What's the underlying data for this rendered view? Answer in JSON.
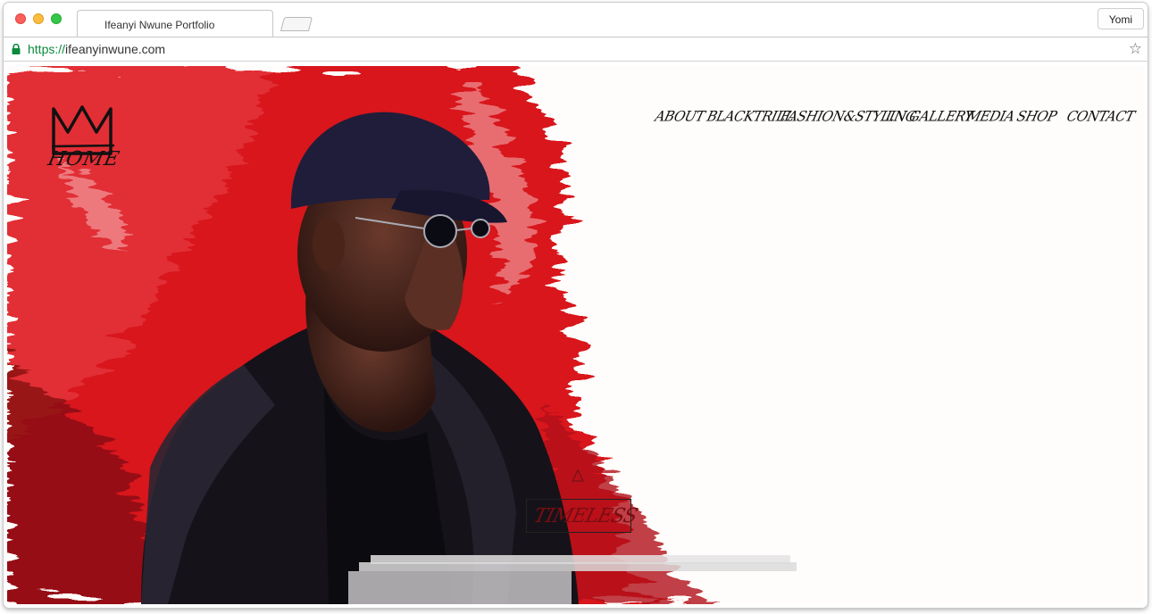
{
  "browser": {
    "tab_title": "Ifeanyi Nwune Portfolio",
    "profile_name": "Yomi",
    "url_scheme": "https://",
    "url_host": "ifeanyinwune.com"
  },
  "site": {
    "home_label": "HOME",
    "nav": [
      {
        "label": "ABOUT"
      },
      {
        "label": "BLACKTRILL"
      },
      {
        "label": "FASHION&STYLING"
      },
      {
        "label": "I.N GALLERY"
      },
      {
        "label": "MEDIA"
      },
      {
        "label": "SHOP"
      },
      {
        "label": "CONTACT"
      }
    ],
    "badge_text": "TIMELESS"
  },
  "colors": {
    "accent_red": "#d8141c",
    "page_bg": "#fffdfb",
    "secure_green": "#0a8a3c"
  },
  "icons": {
    "lock": "lock-icon",
    "star": "star-icon",
    "logo": "crown-icon"
  }
}
